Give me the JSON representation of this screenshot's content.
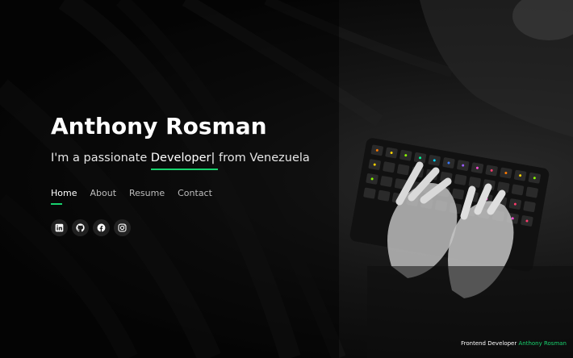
{
  "hero": {
    "name": "Anthony Rosman",
    "tagline_prefix": "I'm a passionate ",
    "typed_word": "Developer",
    "cursor": "|",
    "tagline_suffix": " from Venezuela"
  },
  "nav": {
    "items": [
      {
        "label": "Home",
        "active": true
      },
      {
        "label": "About",
        "active": false
      },
      {
        "label": "Resume",
        "active": false
      },
      {
        "label": "Contact",
        "active": false
      }
    ]
  },
  "social": {
    "icons": [
      "linkedin-icon",
      "github-icon",
      "facebook-icon",
      "instagram-icon"
    ]
  },
  "footer": {
    "role": "Frontend Developer",
    "author": "Anthony Rosman"
  },
  "colors": {
    "accent": "#18d26e",
    "background": "#0b0b0b",
    "text": "#ffffff"
  }
}
